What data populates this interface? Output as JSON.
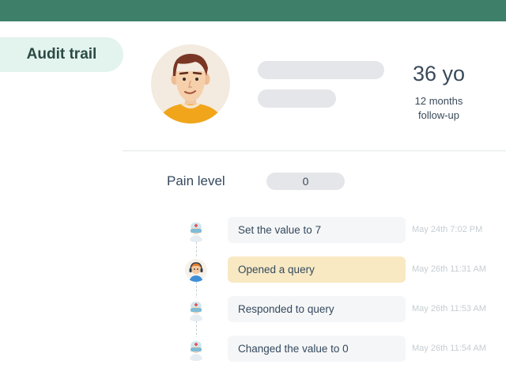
{
  "nav": {
    "audit_trail_label": "Audit trail"
  },
  "patient": {
    "age": "36 yo",
    "followup_line1": "12 months",
    "followup_line2": "follow-up"
  },
  "field": {
    "label": "Pain level",
    "value": "0"
  },
  "timeline": [
    {
      "text": "Set the value to 7",
      "time": "May 24th 7:02 PM",
      "actor_icon": "nurse-avatar-icon",
      "highlight": false
    },
    {
      "text": "Opened a query",
      "time": "May 26th 11:31 AM",
      "actor_icon": "support-agent-avatar-icon",
      "highlight": true
    },
    {
      "text": "Responded to query",
      "time": "May 26th 11:53 AM",
      "actor_icon": "nurse-avatar-icon",
      "highlight": false
    },
    {
      "text": "Changed the value to 0",
      "time": "May 26th 11:54 AM",
      "actor_icon": "nurse-avatar-icon",
      "highlight": false
    }
  ],
  "colors": {
    "header": "#3d7f68",
    "nav_pill_bg": "#e3f3ee",
    "highlight_card": "#f8e9c3",
    "skeleton": "#e5e6ea"
  }
}
